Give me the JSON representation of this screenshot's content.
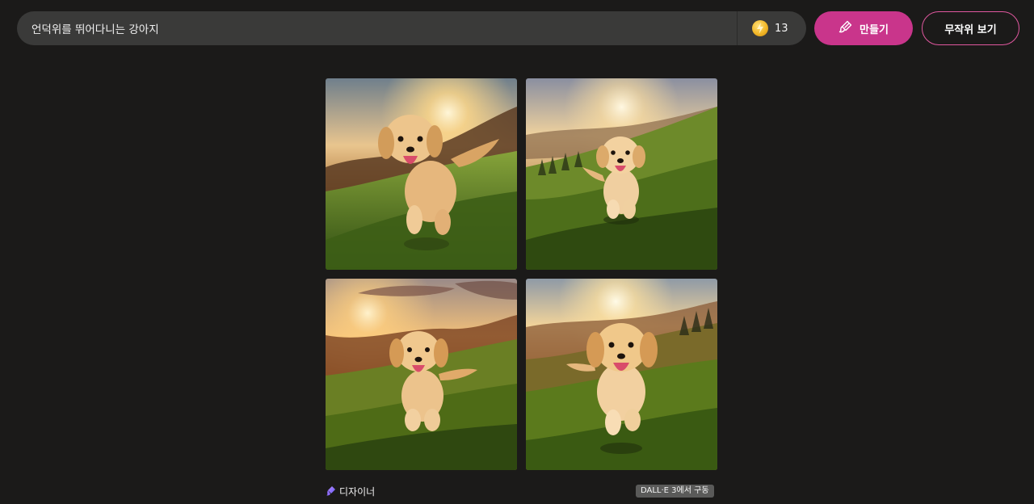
{
  "search": {
    "value": "언덕위를 뛰어다니는 강아지",
    "placeholder": ""
  },
  "boosts": {
    "icon": "coin-bolt-icon",
    "count": "13",
    "color": "#f2b728"
  },
  "actions": {
    "create_label": "만들기",
    "create_icon": "brush-icon",
    "create_color": "#c9358b",
    "surprise_label": "무작위 보기",
    "surprise_border": "#e0589f"
  },
  "results": {
    "images": [
      {
        "alt": "언덕위를 뛰어다니는 강아지"
      },
      {
        "alt": "언덕위를 뛰어다니는 강아지"
      },
      {
        "alt": "언덕위를 뛰어다니는 강아지"
      },
      {
        "alt": "언덕위를 뛰어다니는 강아지"
      }
    ]
  },
  "footer": {
    "brand_icon": "designer-logo-icon",
    "brand_label": "디자이너",
    "powered_by": "DALL·E 3에서 구동"
  }
}
